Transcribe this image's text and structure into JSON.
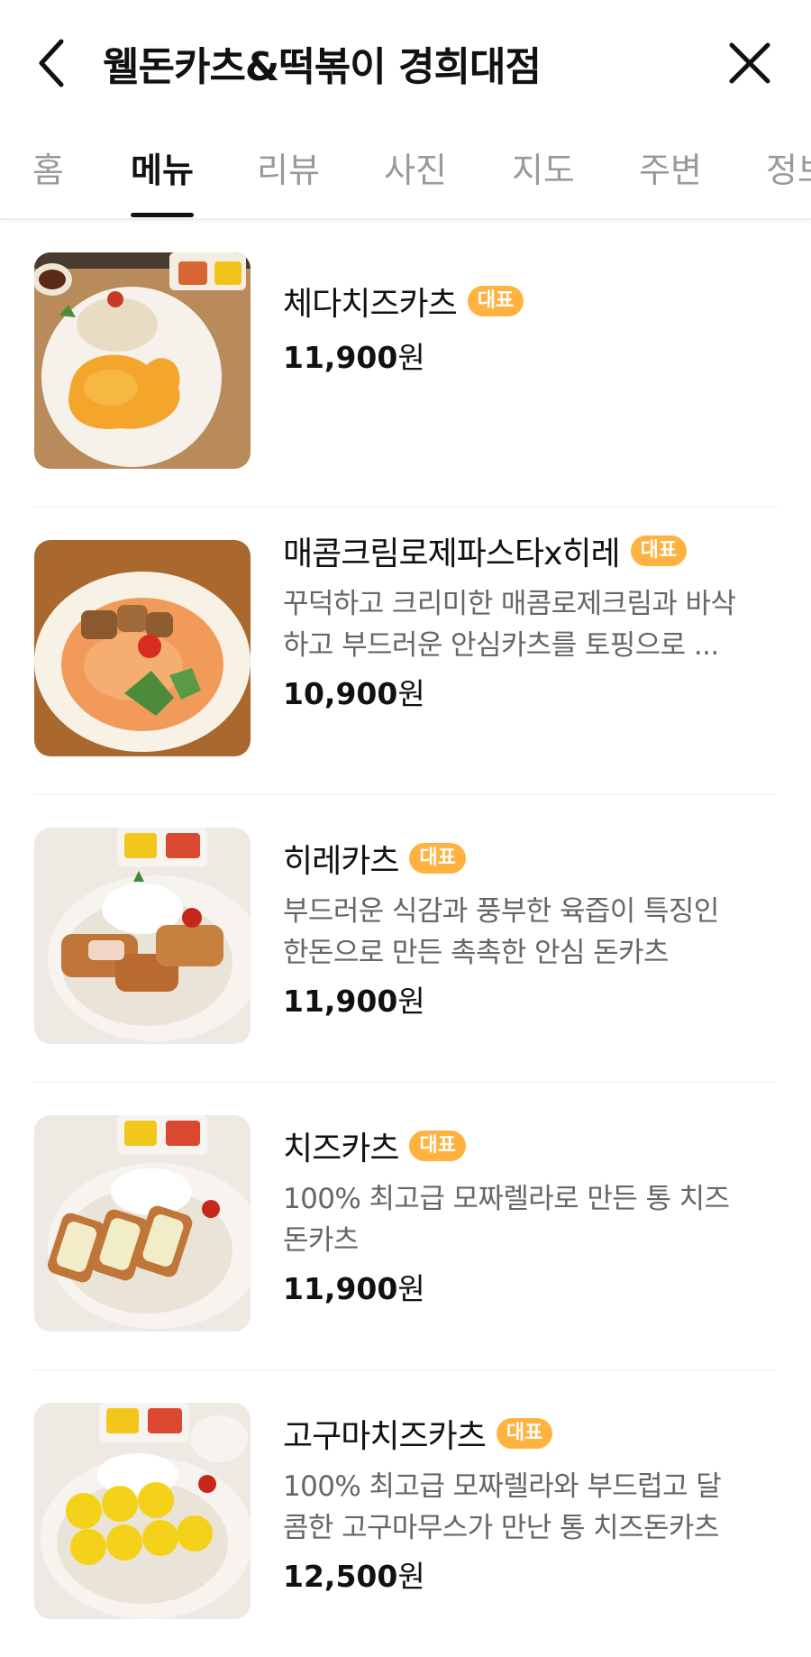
{
  "header": {
    "title": "웰돈카츠&떡볶이 경희대점",
    "back_icon": "chevron-left-icon",
    "close_icon": "close-icon"
  },
  "tabs": [
    {
      "label": "홈"
    },
    {
      "label": "메뉴",
      "active": true
    },
    {
      "label": "리뷰"
    },
    {
      "label": "사진"
    },
    {
      "label": "지도"
    },
    {
      "label": "주변"
    },
    {
      "label": "정보"
    }
  ],
  "colors": {
    "badge": "#ffb23f",
    "active_tab": "#111111",
    "inactive_tab": "#9a9a9a"
  },
  "menu": [
    {
      "name": "체다치즈카츠",
      "badge": "대표",
      "desc1": "",
      "desc2": "",
      "price": "11,900",
      "unit": "원"
    },
    {
      "name": "매콤크림로제파스타x히레",
      "badge": "대표",
      "desc1": "꾸덕하고 크리미한 매콤로제크림과 바삭",
      "desc2": "하고 부드러운 안심카츠를 토핑으로 ...",
      "price": "10,900",
      "unit": "원"
    },
    {
      "name": "히레카츠",
      "badge": "대표",
      "desc1": "부드러운 식감과 풍부한 육즙이 특징인",
      "desc2": "한돈으로 만든 촉촉한 안심 돈카츠",
      "price": "11,900",
      "unit": "원"
    },
    {
      "name": "치즈카츠",
      "badge": "대표",
      "desc1": "100% 최고급 모짜렐라로 만든 통 치즈",
      "desc2": "돈카츠",
      "price": "11,900",
      "unit": "원"
    },
    {
      "name": "고구마치즈카츠",
      "badge": "대표",
      "desc1": "100% 최고급 모짜렐라와 부드럽고 달",
      "desc2": "콤한 고구마무스가 만난 통 치즈돈카츠",
      "price": "12,500",
      "unit": "원"
    }
  ]
}
